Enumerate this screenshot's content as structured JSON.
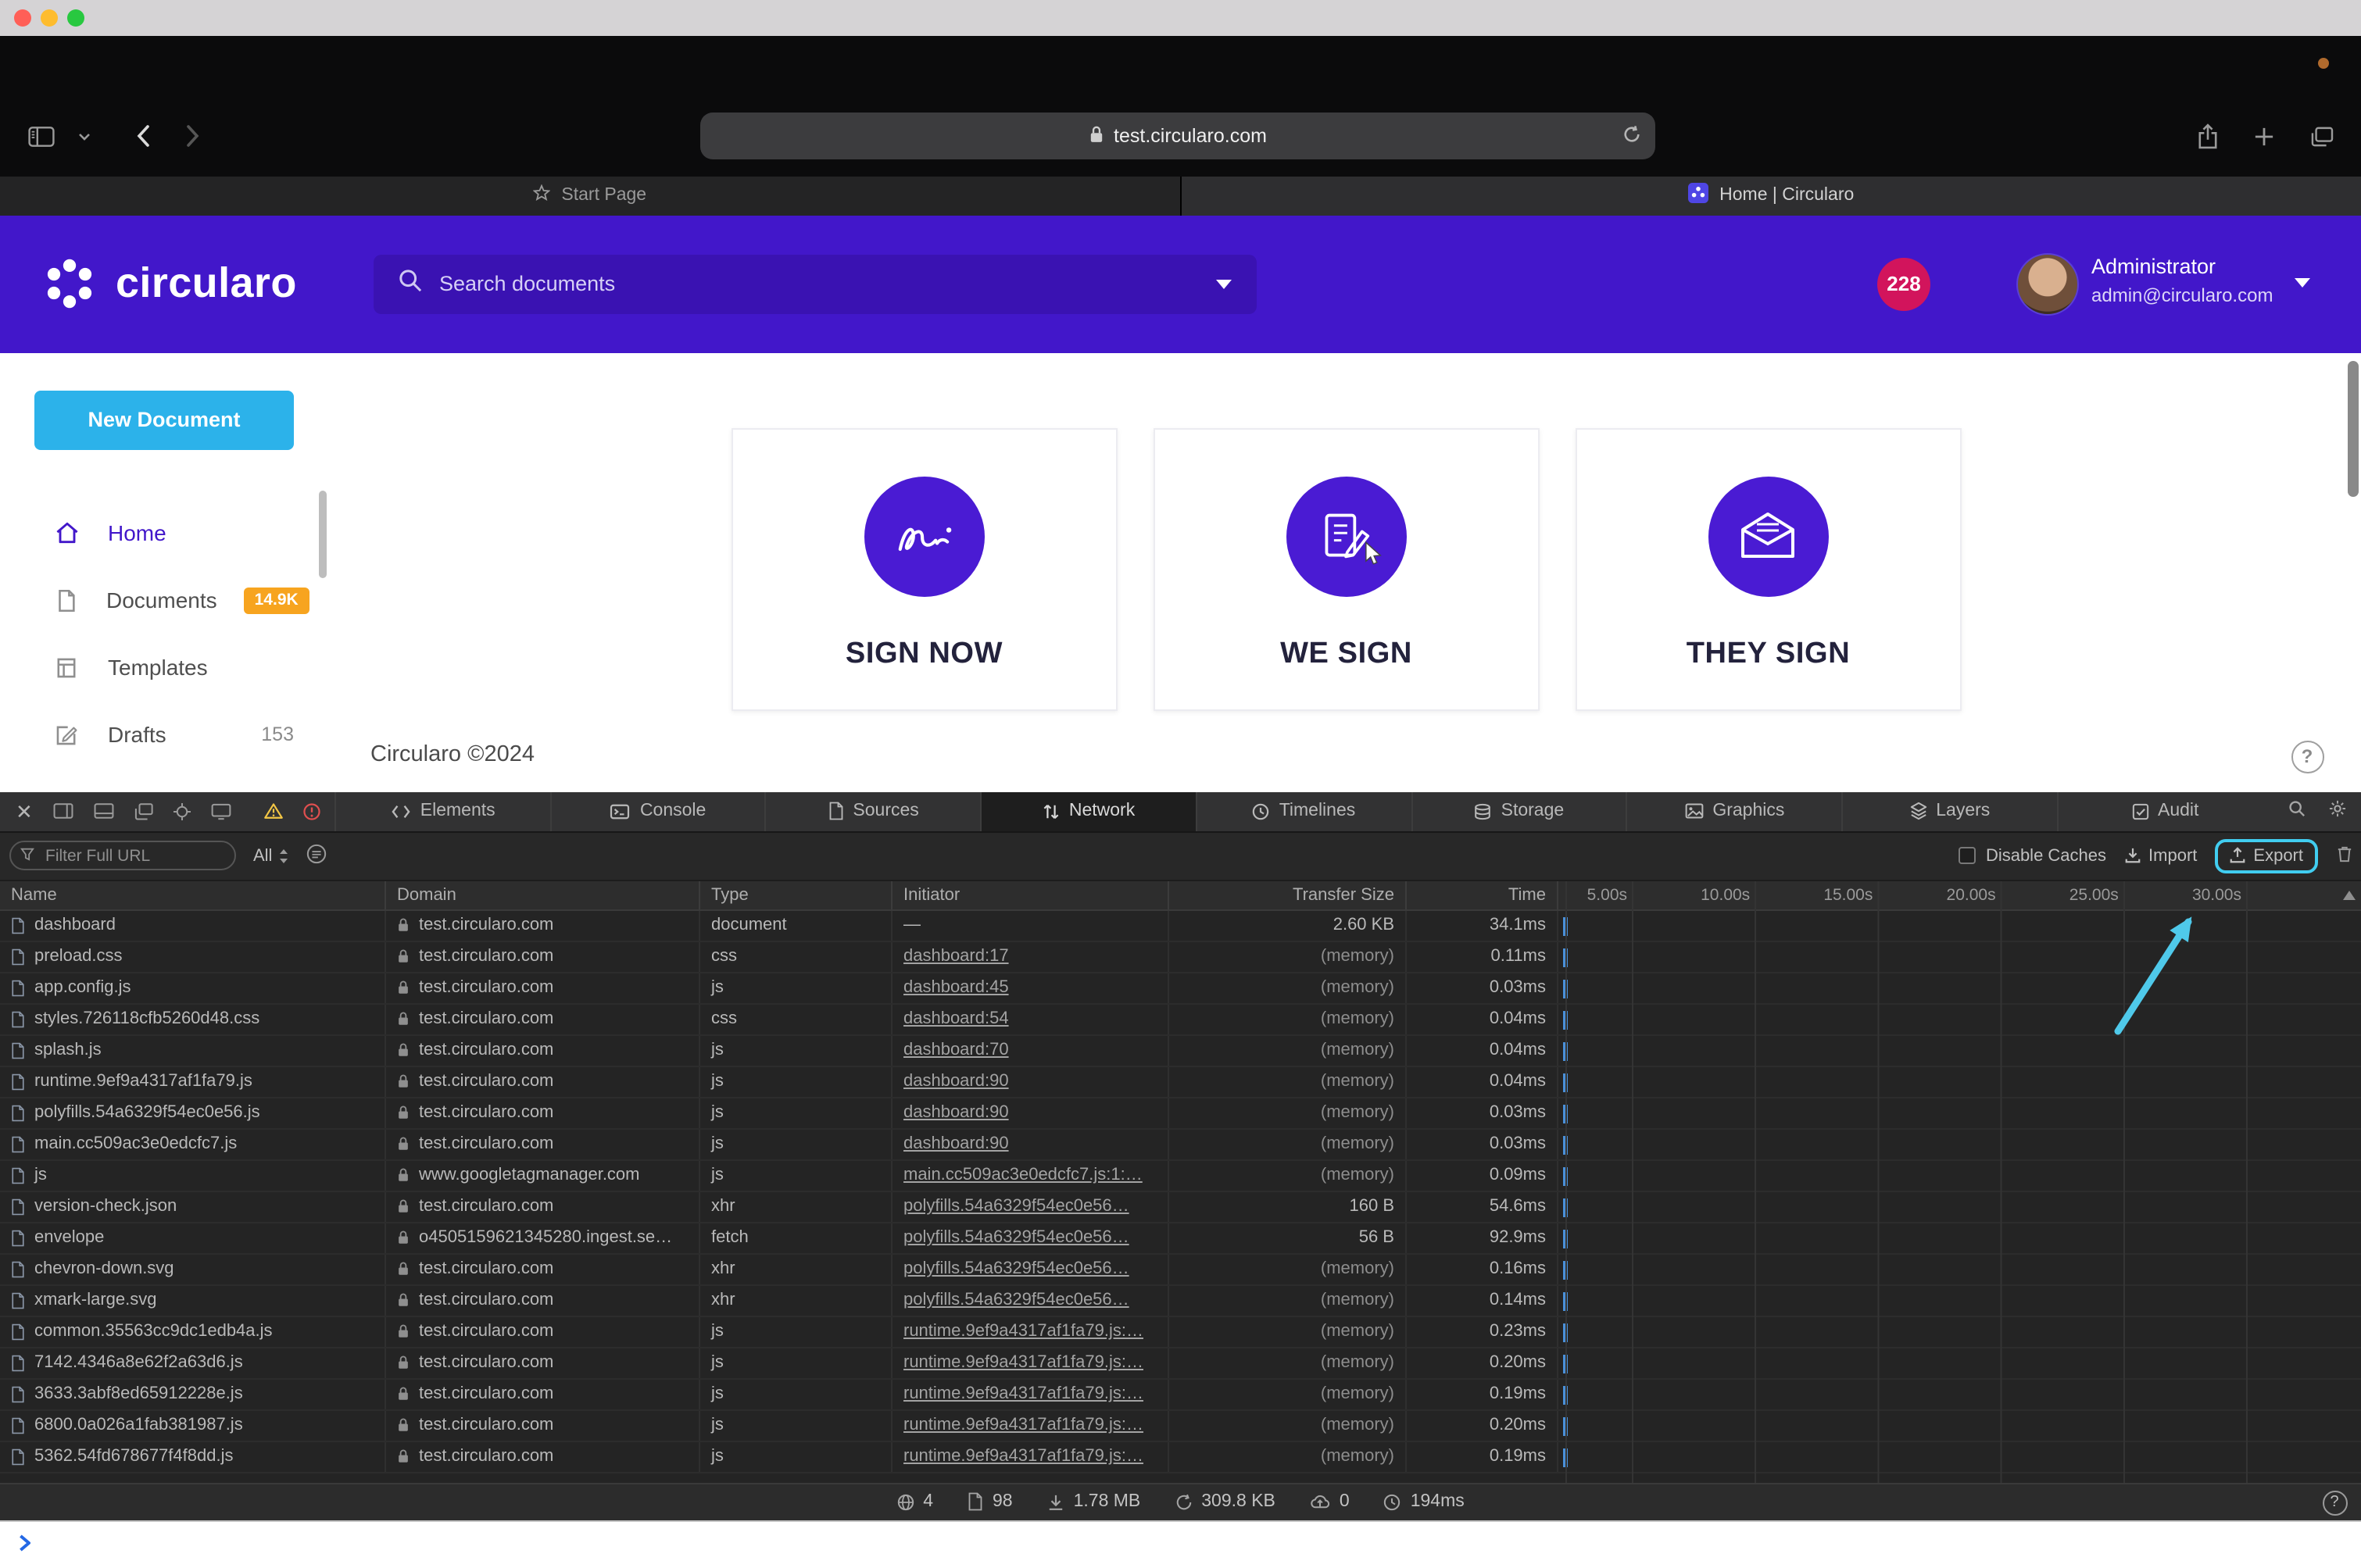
{
  "browser": {
    "url": "test.circularo.com",
    "tab_start": "Start Page",
    "tab_home": "Home | Circularo"
  },
  "header": {
    "brand": "circularo",
    "search_placeholder": "Search documents",
    "notification_count": "228",
    "user_name": "Administrator",
    "user_email": "admin@circularo.com"
  },
  "sidebar": {
    "new_document": "New Document",
    "items": [
      {
        "label": "Home",
        "icon": "home-icon",
        "badge": "",
        "badge_style": "",
        "active": true
      },
      {
        "label": "Documents",
        "icon": "document-icon",
        "badge": "14.9K",
        "badge_style": "pill",
        "active": false
      },
      {
        "label": "Templates",
        "icon": "template-icon",
        "badge": "",
        "badge_style": "",
        "active": false
      },
      {
        "label": "Drafts",
        "icon": "draft-icon",
        "badge": "153",
        "badge_style": "plain",
        "active": false
      }
    ]
  },
  "main": {
    "cards": [
      {
        "title": "SIGN NOW",
        "icon": "signature-icon"
      },
      {
        "title": "WE SIGN",
        "icon": "pen-document-icon"
      },
      {
        "title": "THEY SIGN",
        "icon": "envelope-pen-icon"
      }
    ],
    "footer": "Circularo ©2024"
  },
  "inspector": {
    "tabs": [
      {
        "label": "Elements",
        "icon": "elements-icon",
        "active": false
      },
      {
        "label": "Console",
        "icon": "console-icon",
        "active": false
      },
      {
        "label": "Sources",
        "icon": "sources-icon",
        "active": false
      },
      {
        "label": "Network",
        "icon": "network-icon",
        "active": true
      },
      {
        "label": "Timelines",
        "icon": "timelines-icon",
        "active": false
      },
      {
        "label": "Storage",
        "icon": "storage-icon",
        "active": false
      },
      {
        "label": "Graphics",
        "icon": "graphics-icon",
        "active": false
      },
      {
        "label": "Layers",
        "icon": "layers-icon",
        "active": false
      },
      {
        "label": "Audit",
        "icon": "audit-icon",
        "active": false
      }
    ],
    "filter_placeholder": "Filter Full URL",
    "scope_label": "All",
    "disable_caches_label": "Disable Caches",
    "import_label": "Import",
    "export_label": "Export",
    "table": {
      "columns": [
        "Name",
        "Domain",
        "Type",
        "Initiator",
        "Transfer Size",
        "Time"
      ],
      "timeline_ticks": [
        "5.00s",
        "10.00s",
        "15.00s",
        "20.00s",
        "25.00s",
        "30.00s"
      ],
      "rows": [
        {
          "name": "dashboard",
          "domain": "test.circularo.com",
          "type": "document",
          "initiator": "—",
          "initiator_link": false,
          "size": "2.60 KB",
          "time": "34.1ms"
        },
        {
          "name": "preload.css",
          "domain": "test.circularo.com",
          "type": "css",
          "initiator": "dashboard:17",
          "initiator_link": true,
          "size": "(memory)",
          "time": "0.11ms"
        },
        {
          "name": "app.config.js",
          "domain": "test.circularo.com",
          "type": "js",
          "initiator": "dashboard:45",
          "initiator_link": true,
          "size": "(memory)",
          "time": "0.03ms"
        },
        {
          "name": "styles.726118cfb5260d48.css",
          "domain": "test.circularo.com",
          "type": "css",
          "initiator": "dashboard:54",
          "initiator_link": true,
          "size": "(memory)",
          "time": "0.04ms"
        },
        {
          "name": "splash.js",
          "domain": "test.circularo.com",
          "type": "js",
          "initiator": "dashboard:70",
          "initiator_link": true,
          "size": "(memory)",
          "time": "0.04ms"
        },
        {
          "name": "runtime.9ef9a4317af1fa79.js",
          "domain": "test.circularo.com",
          "type": "js",
          "initiator": "dashboard:90",
          "initiator_link": true,
          "size": "(memory)",
          "time": "0.04ms"
        },
        {
          "name": "polyfills.54a6329f54ec0e56.js",
          "domain": "test.circularo.com",
          "type": "js",
          "initiator": "dashboard:90",
          "initiator_link": true,
          "size": "(memory)",
          "time": "0.03ms"
        },
        {
          "name": "main.cc509ac3e0edcfc7.js",
          "domain": "test.circularo.com",
          "type": "js",
          "initiator": "dashboard:90",
          "initiator_link": true,
          "size": "(memory)",
          "time": "0.03ms"
        },
        {
          "name": "js",
          "domain": "www.googletagmanager.com",
          "type": "js",
          "initiator": "main.cc509ac3e0edcfc7.js:1:…",
          "initiator_link": true,
          "size": "(memory)",
          "time": "0.09ms"
        },
        {
          "name": "version-check.json",
          "domain": "test.circularo.com",
          "type": "xhr",
          "initiator": "polyfills.54a6329f54ec0e56…",
          "initiator_link": true,
          "size": "160 B",
          "time": "54.6ms"
        },
        {
          "name": "envelope",
          "domain": "o4505159621345280.ingest.se…",
          "type": "fetch",
          "initiator": "polyfills.54a6329f54ec0e56…",
          "initiator_link": true,
          "size": "56 B",
          "time": "92.9ms"
        },
        {
          "name": "chevron-down.svg",
          "domain": "test.circularo.com",
          "type": "xhr",
          "initiator": "polyfills.54a6329f54ec0e56…",
          "initiator_link": true,
          "size": "(memory)",
          "time": "0.16ms"
        },
        {
          "name": "xmark-large.svg",
          "domain": "test.circularo.com",
          "type": "xhr",
          "initiator": "polyfills.54a6329f54ec0e56…",
          "initiator_link": true,
          "size": "(memory)",
          "time": "0.14ms"
        },
        {
          "name": "common.35563cc9dc1edb4a.js",
          "domain": "test.circularo.com",
          "type": "js",
          "initiator": "runtime.9ef9a4317af1fa79.js:…",
          "initiator_link": true,
          "size": "(memory)",
          "time": "0.23ms"
        },
        {
          "name": "7142.4346a8e62f2a63d6.js",
          "domain": "test.circularo.com",
          "type": "js",
          "initiator": "runtime.9ef9a4317af1fa79.js:…",
          "initiator_link": true,
          "size": "(memory)",
          "time": "0.20ms"
        },
        {
          "name": "3633.3abf8ed65912228e.js",
          "domain": "test.circularo.com",
          "type": "js",
          "initiator": "runtime.9ef9a4317af1fa79.js:…",
          "initiator_link": true,
          "size": "(memory)",
          "time": "0.19ms"
        },
        {
          "name": "6800.0a026a1fab381987.js",
          "domain": "test.circularo.com",
          "type": "js",
          "initiator": "runtime.9ef9a4317af1fa79.js:…",
          "initiator_link": true,
          "size": "(memory)",
          "time": "0.20ms"
        },
        {
          "name": "5362.54fd678677f4f8dd.js",
          "domain": "test.circularo.com",
          "type": "js",
          "initiator": "runtime.9ef9a4317af1fa79.js:…",
          "initiator_link": true,
          "size": "(memory)",
          "time": "0.19ms"
        }
      ]
    },
    "status": [
      {
        "icon": "globe-icon",
        "value": "4"
      },
      {
        "icon": "resources-icon",
        "value": "98"
      },
      {
        "icon": "size-icon",
        "value": "1.78 MB"
      },
      {
        "icon": "transfer-icon",
        "value": "309.8 KB"
      },
      {
        "icon": "upload-icon",
        "value": "0"
      },
      {
        "icon": "time-icon",
        "value": "194ms"
      }
    ]
  },
  "annotation": {
    "highlight_target": "Export",
    "color": "#41cdf0"
  }
}
